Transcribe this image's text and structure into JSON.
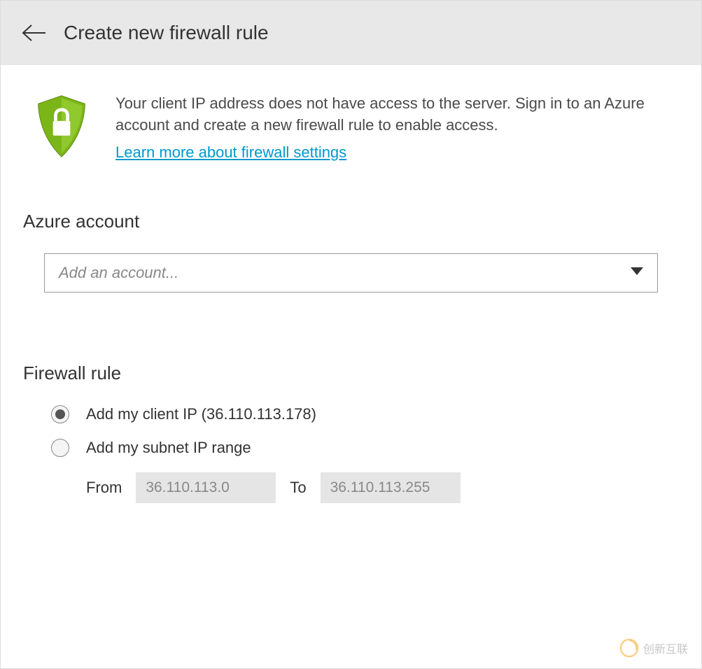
{
  "header": {
    "title": "Create new firewall rule"
  },
  "info": {
    "description": "Your client IP address does not have access to the server. Sign in to an Azure account and create a new firewall rule to enable access.",
    "learnLink": "Learn more about firewall settings"
  },
  "azure": {
    "sectionTitle": "Azure account",
    "dropdownPlaceholder": "Add an account..."
  },
  "firewall": {
    "sectionTitle": "Firewall rule",
    "option1": "Add my client IP (36.110.113.178)",
    "option2": "Add my subnet IP range",
    "fromLabel": "From",
    "toLabel": "To",
    "fromValue": "36.110.113.0",
    "toValue": "36.110.113.255"
  },
  "watermark": {
    "text": "创新互联"
  }
}
